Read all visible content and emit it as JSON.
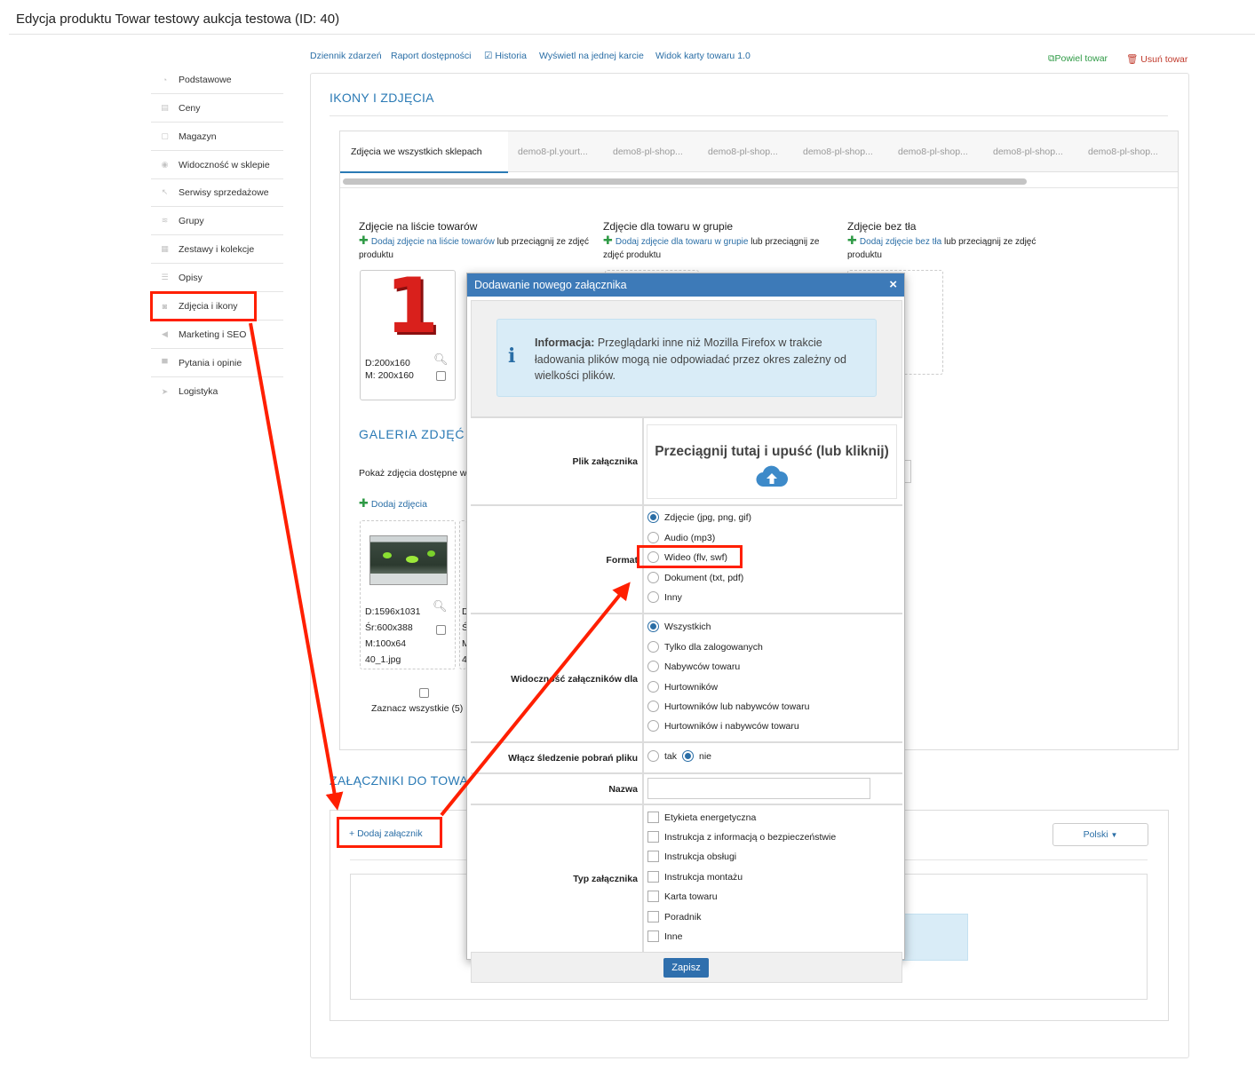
{
  "page": {
    "title": "Edycja produktu Towar testowy aukcja testowa (ID: 40)"
  },
  "sidebar": {
    "items": [
      {
        "label": "Podstawowe",
        "icon": "speedometer-icon"
      },
      {
        "label": "Ceny",
        "icon": "price-icon"
      },
      {
        "label": "Magazyn",
        "icon": "box-icon"
      },
      {
        "label": "Widoczność w sklepie",
        "icon": "eye-icon"
      },
      {
        "label": "Serwisy sprzedażowe",
        "icon": "hammer-icon"
      },
      {
        "label": "Grupy",
        "icon": "layers-icon"
      },
      {
        "label": "Zestawy i kolekcje",
        "icon": "stack-icon"
      },
      {
        "label": "Opisy",
        "icon": "text-lines-icon"
      },
      {
        "label": "Zdjęcia i ikony",
        "icon": "camera-icon"
      },
      {
        "label": "Marketing i SEO",
        "icon": "megaphone-icon"
      },
      {
        "label": "Pytania i opinie",
        "icon": "chat-icon"
      },
      {
        "label": "Logistyka",
        "icon": "paper-plane-icon"
      }
    ]
  },
  "toplinks": {
    "events": "Dziennik zdarzeń",
    "availability": "Raport dostępności",
    "history": "Historia",
    "single_card": "Wyświetl na jednej karcie",
    "card_view": "Widok karty towaru 1.0",
    "duplicate": "Powiel towar",
    "delete": "Usuń towar"
  },
  "section_icons": {
    "title": "IKONY I ZDJĘCIA",
    "tabs": [
      "Zdjęcia we wszystkich sklepach",
      "demo8-pl.yourt...",
      "demo8-pl-shop...",
      "demo8-pl-shop...",
      "demo8-pl-shop...",
      "demo8-pl-shop...",
      "demo8-pl-shop...",
      "demo8-pl-shop..."
    ],
    "col1": {
      "title": "Zdjęcie na liście towarów",
      "link": "Dodaj zdjęcie",
      "mid": " na liście towarów",
      "rest": " lub przeciągnij ze zdjęć produktu"
    },
    "col2": {
      "title": "Zdjęcie dla towaru w grupie",
      "link": "Dodaj zdjęcie",
      "mid": " dla towaru w grupie",
      "rest": " lub przeciągnij ze zdjęć produktu"
    },
    "col3": {
      "title": "Zdjęcie bez tła",
      "link": "Dodaj zdjęcie",
      "mid": " bez tła",
      "rest": " lub przeciągnij ze zdjęć produktu"
    },
    "thumb1": {
      "glyph": "1",
      "d": "D:200x160",
      "m": "M: 200x160"
    },
    "gallery_title": "GALERIA ZDJĘĆ",
    "gallery_show": "Pokaż zdjęcia dostępne w",
    "gallery_add": "Dodaj zdjęcia",
    "gallery_item": {
      "d": "D:1596x1031",
      "sr": "Śr:600x388",
      "m": "M:100x64",
      "file": "40_1.jpg"
    },
    "gallery_peek": [
      "D",
      "Ś",
      "M",
      "4"
    ],
    "select_all": "Zaznacz wszystkie (5)"
  },
  "attachments": {
    "title": "ZAŁĄCZNIKI DO TOWARU",
    "add": "Dodaj załącznik",
    "language": "Polski"
  },
  "modal": {
    "title": "Dodawanie nowego załącznika",
    "close": "×",
    "info_bold": "Informacja:",
    "info_text": " Przeglądarki inne niż Mozilla Firefox w trakcie ładowania plików mogą nie odpowiadać przez okres zależny od wielkości plików.",
    "file_label": "Plik załącznika",
    "drop_text": "Przeciągnij tutaj i upuść (lub kliknij)",
    "format_label": "Format",
    "formats": [
      "Zdjęcie (jpg, png, gif)",
      "Audio (mp3)",
      "Wideo (flv, swf)",
      "Dokument (txt, pdf)",
      "Inny"
    ],
    "format_selected": 0,
    "visibility_label": "Widoczność załączników dla",
    "visibility": [
      "Wszystkich",
      "Tylko dla zalogowanych",
      "Nabywców towaru",
      "Hurtowników",
      "Hurtowników lub nabywców towaru",
      "Hurtowników i nabywców towaru"
    ],
    "visibility_selected": 0,
    "tracking_label": "Włącz śledzenie pobrań pliku",
    "tracking_yes": "tak",
    "tracking_no": "nie",
    "tracking_selected": "nie",
    "name_label": "Nazwa",
    "name_value": "",
    "type_label": "Typ załącznika",
    "types": [
      "Etykieta energetyczna",
      "Instrukcja z informacją o bezpieczeństwie",
      "Instrukcja obsługi",
      "Instrukcja montażu",
      "Karta towaru",
      "Poradnik",
      "Inne"
    ],
    "save": "Zapisz"
  },
  "colors": {
    "accent_blue": "#2a6ea6",
    "header_blue": "#3d7ab8",
    "annotation_red": "#ff1f00",
    "plus_green": "#2e9a45"
  }
}
